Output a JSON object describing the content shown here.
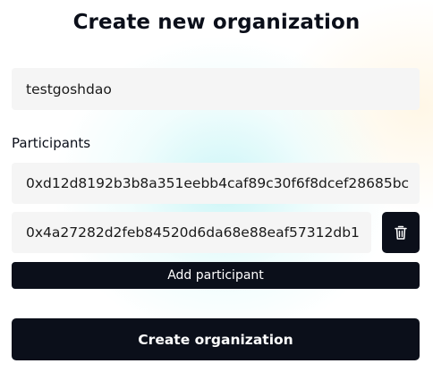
{
  "title": "Create new organization",
  "name_field": {
    "value": "testgoshdao"
  },
  "participants": {
    "label": "Participants",
    "items": [
      {
        "value": "0xd12d8192b3b8a351eebb4caf89c30f6f8dcef28685bc"
      },
      {
        "value": "0x4a27282d2feb84520d6da68e88eaf57312db1"
      }
    ],
    "delete_icon": "trash-icon",
    "add_label": "Add participant"
  },
  "submit_label": "Create organization",
  "colors": {
    "button_bg": "#0b0f1a",
    "input_bg": "#f5f5f5",
    "text": "#0b0f1a"
  }
}
